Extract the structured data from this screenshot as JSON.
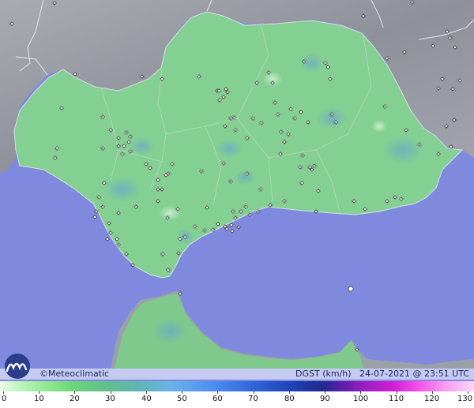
{
  "credit": "©Meteoclimatic",
  "caption": {
    "variable": "DGST (km/h)",
    "date": "24-07-2021",
    "separator": "@",
    "time": "23:51 UTC"
  },
  "scale": {
    "unit": "km/h",
    "ticks": [
      "0",
      "10",
      "20",
      "30",
      "40",
      "50",
      "60",
      "70",
      "80",
      "90",
      "100",
      "110",
      "120",
      "130"
    ]
  },
  "colors": {
    "sea": "#7f8adf",
    "land_low": "#8fd495",
    "land_mid": "#7ac98a",
    "neighbour_land": "#9b9ea6",
    "borders": "#d9d9e6"
  },
  "stations": {
    "marker": "diamond-outline",
    "count_visible": 176
  }
}
